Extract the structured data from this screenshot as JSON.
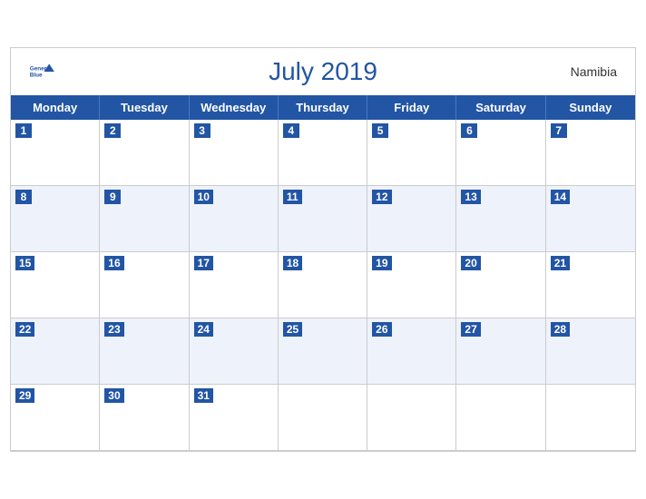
{
  "calendar": {
    "title": "July 2019",
    "country": "Namibia",
    "days_of_week": [
      "Monday",
      "Tuesday",
      "Wednesday",
      "Thursday",
      "Friday",
      "Saturday",
      "Sunday"
    ],
    "weeks": [
      {
        "dates": [
          1,
          2,
          3,
          4,
          5,
          6,
          7
        ],
        "shaded": false
      },
      {
        "dates": [
          8,
          9,
          10,
          11,
          12,
          13,
          14
        ],
        "shaded": true
      },
      {
        "dates": [
          15,
          16,
          17,
          18,
          19,
          20,
          21
        ],
        "shaded": false
      },
      {
        "dates": [
          22,
          23,
          24,
          25,
          26,
          27,
          28
        ],
        "shaded": true
      },
      {
        "dates": [
          29,
          30,
          31,
          null,
          null,
          null,
          null
        ],
        "shaded": false
      }
    ],
    "logo": {
      "brand": "General",
      "color": "Blue"
    }
  }
}
